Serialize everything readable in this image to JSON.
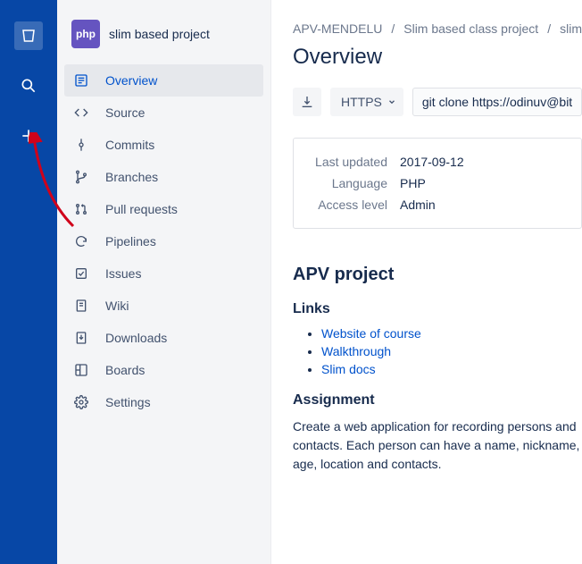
{
  "project": {
    "avatar_text": "php",
    "title": "slim based project"
  },
  "nav": {
    "items": [
      {
        "label": "Overview",
        "active": true
      },
      {
        "label": "Source"
      },
      {
        "label": "Commits"
      },
      {
        "label": "Branches"
      },
      {
        "label": "Pull requests"
      },
      {
        "label": "Pipelines"
      },
      {
        "label": "Issues"
      },
      {
        "label": "Wiki"
      },
      {
        "label": "Downloads"
      },
      {
        "label": "Boards"
      },
      {
        "label": "Settings"
      }
    ]
  },
  "breadcrumbs": [
    "APV-MENDELU",
    "Slim based class project",
    "slim b"
  ],
  "page_title": "Overview",
  "clone": {
    "protocol": "HTTPS",
    "command": "git clone https://odinuv@bitb"
  },
  "meta": [
    {
      "label": "Last updated",
      "value": "2017-09-12"
    },
    {
      "label": "Language",
      "value": "PHP"
    },
    {
      "label": "Access level",
      "value": "Admin"
    }
  ],
  "readme": {
    "title": "APV project",
    "links_heading": "Links",
    "links": [
      {
        "text": "Website of course"
      },
      {
        "text": "Walkthrough"
      },
      {
        "text": "Slim docs"
      }
    ],
    "assignment_heading": "Assignment",
    "assignment_text": "Create a web application for recording persons and contacts. Each person can have a name, nickname, age, location and contacts."
  }
}
